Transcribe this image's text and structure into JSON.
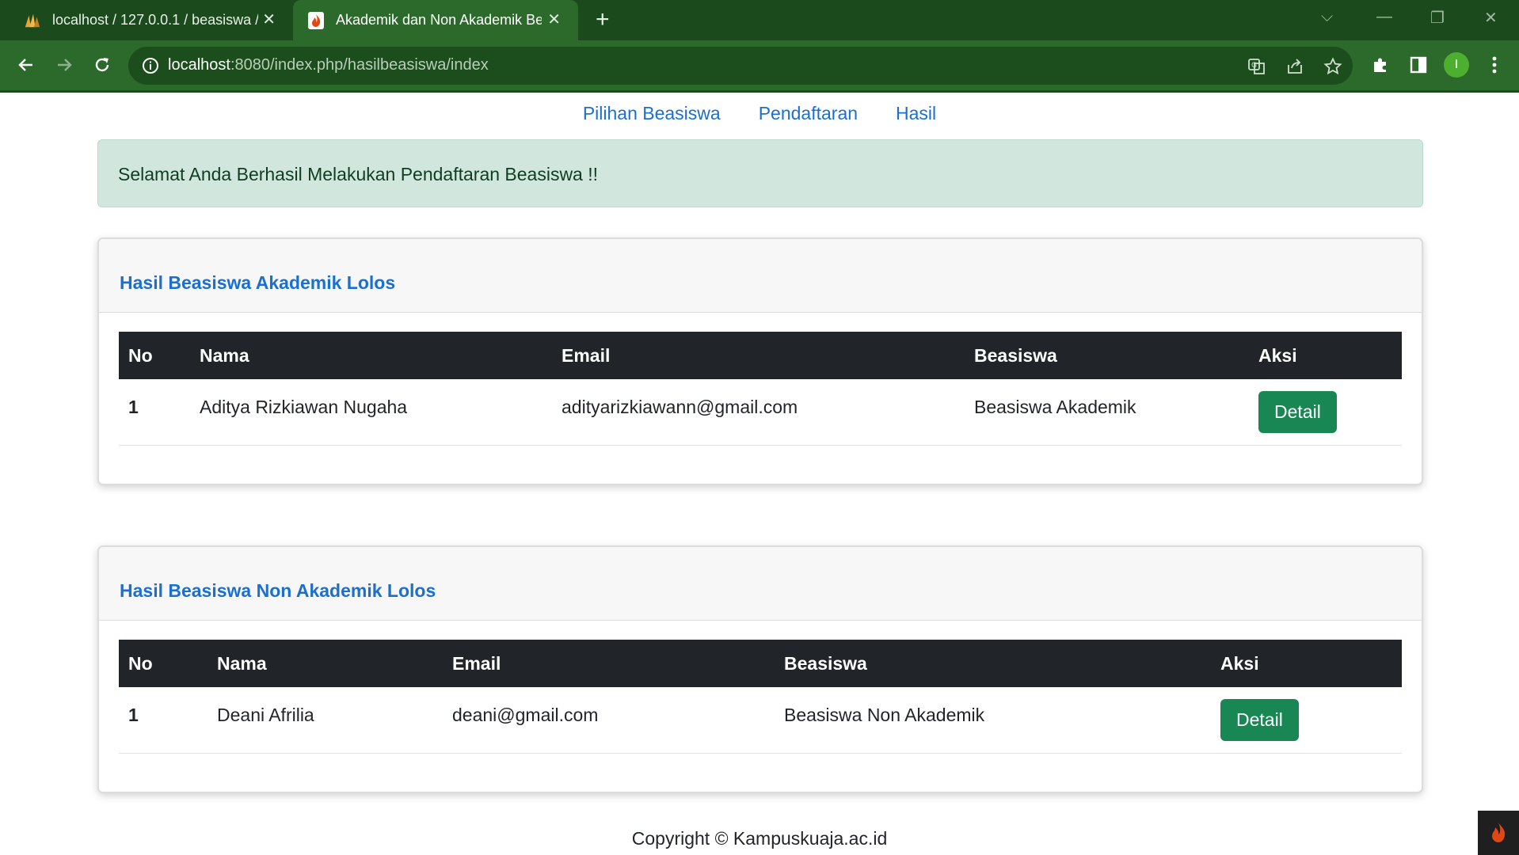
{
  "browser": {
    "tabs": [
      {
        "title": "localhost / 127.0.0.1 / beasiswa / ",
        "close": "✕"
      },
      {
        "title": "Akademik dan Non Akademik Be",
        "close": "✕"
      }
    ],
    "new_tab": "+",
    "window_controls": {
      "tabs_menu": "⌵",
      "minimize": "—",
      "restore": "❐",
      "close": "✕"
    },
    "url_host": "localhost",
    "url_path": ":8080/index.php/hasilbeasiswa/index",
    "profile_initial": "I",
    "accent": "#2b6a2a"
  },
  "nav": {
    "links": [
      "Pilihan Beasiswa",
      "Pendaftaran",
      "Hasil"
    ]
  },
  "alert": {
    "message": "Selamat Anda Berhasil Melakukan Pendaftaran Beasiswa !!"
  },
  "akademik": {
    "title": "Hasil Beasiswa Akademik Lolos",
    "headers": [
      "No",
      "Nama",
      "Email",
      "Beasiswa",
      "Aksi"
    ],
    "rows": [
      {
        "no": "1",
        "nama": "Aditya Rizkiawan Nugaha",
        "email": "adityarizkiawann@gmail.com",
        "beasiswa": "Beasiswa Akademik",
        "aksi": "Detail"
      }
    ]
  },
  "non_akademik": {
    "title": "Hasil Beasiswa Non Akademik Lolos",
    "headers": [
      "No",
      "Nama",
      "Email",
      "Beasiswa",
      "Aksi"
    ],
    "rows": [
      {
        "no": "1",
        "nama": "Deani Afrilia",
        "email": "deani@gmail.com",
        "beasiswa": "Beasiswa Non Akademik",
        "aksi": "Detail"
      }
    ]
  },
  "footer": {
    "text": "Copyright © Kampuskuaja.ac.id"
  },
  "colors": {
    "link": "#1a6fd1",
    "alert_bg": "#d1e7dd",
    "table_header": "#212529",
    "button": "#198754"
  }
}
